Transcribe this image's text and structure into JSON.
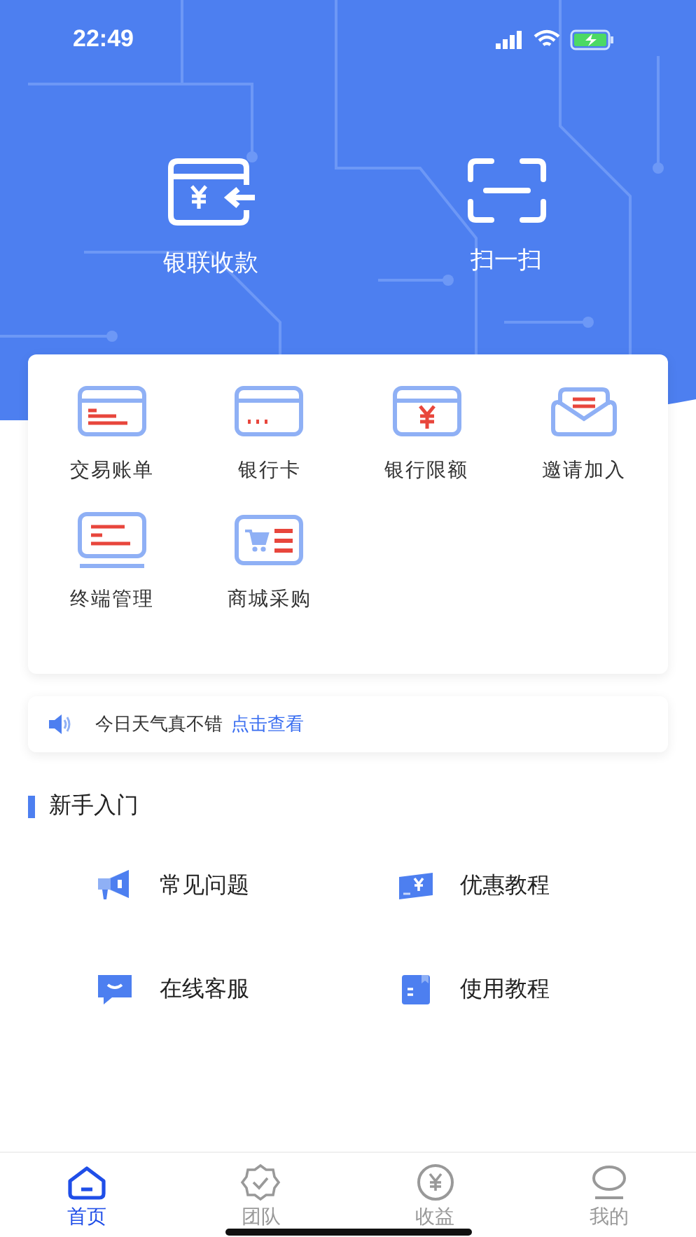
{
  "status_bar": {
    "time": "22:49"
  },
  "header_actions": [
    {
      "label": "银联收款",
      "kind": "card-receive"
    },
    {
      "label": "扫一扫",
      "kind": "scan"
    }
  ],
  "menu": [
    {
      "label": "交易账单",
      "kind": "bill"
    },
    {
      "label": "银行卡",
      "kind": "card"
    },
    {
      "label": "银行限额",
      "kind": "limit"
    },
    {
      "label": "邀请加入",
      "kind": "invite"
    },
    {
      "label": "终端管理",
      "kind": "terminal"
    },
    {
      "label": "商城采购",
      "kind": "shop"
    }
  ],
  "notice": {
    "text": "今日天气真不错",
    "link": "点击查看"
  },
  "guide": {
    "title": "新手入门",
    "items": [
      {
        "label": "常见问题",
        "kind": "faq"
      },
      {
        "label": "优惠教程",
        "kind": "discount"
      },
      {
        "label": "在线客服",
        "kind": "service"
      },
      {
        "label": "使用教程",
        "kind": "tutorial"
      }
    ]
  },
  "tabs": [
    {
      "label": "首页",
      "kind": "home",
      "selected": true
    },
    {
      "label": "团队",
      "kind": "team",
      "selected": false
    },
    {
      "label": "收益",
      "kind": "income",
      "selected": false
    },
    {
      "label": "我的",
      "kind": "mine",
      "selected": false
    }
  ]
}
